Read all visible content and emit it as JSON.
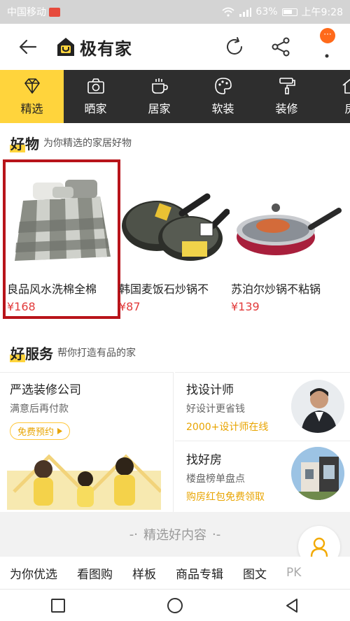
{
  "status_bar": {
    "carrier": "中国移动",
    "battery": "63%",
    "time": "上午9:28"
  },
  "app": {
    "brand": "极有家",
    "more_badge": "···"
  },
  "tabs": [
    {
      "label": "精选",
      "icon": "diamond-icon",
      "active": true
    },
    {
      "label": "晒家",
      "icon": "camera-icon",
      "active": false
    },
    {
      "label": "居家",
      "icon": "cup-icon",
      "active": false
    },
    {
      "label": "软装",
      "icon": "palette-icon",
      "active": false
    },
    {
      "label": "装修",
      "icon": "paint-roller-icon",
      "active": false
    },
    {
      "label": "房",
      "icon": "house-icon",
      "active": false
    }
  ],
  "goods": {
    "title_hl": "好",
    "title_rest": "物",
    "subtitle": "为你精选的家居好物",
    "products": [
      {
        "name": "良品风水洗棉全棉",
        "price": "¥168"
      },
      {
        "name": "韩国麦饭石炒锅不",
        "price": "¥87"
      },
      {
        "name": "苏泊尔炒锅不粘锅",
        "price": "¥139"
      }
    ]
  },
  "services": {
    "title_hl": "好",
    "title_rest": "服务",
    "subtitle": "帮你打造有品的家",
    "renovation": {
      "title": "严选装修公司",
      "sub": "满意后再付款",
      "button": "免费预约"
    },
    "designer": {
      "title": "找设计师",
      "sub": "好设计更省钱",
      "highlight": "2000+设计师在线"
    },
    "house": {
      "title": "找好房",
      "sub": "楼盘榜单盘点",
      "highlight": "购房红包免费领取"
    }
  },
  "recommend": {
    "label": "精选好内容"
  },
  "bottom_tabs": [
    "为你优选",
    "看图购",
    "样板",
    "商品专辑",
    "图文",
    "PK"
  ],
  "colors": {
    "accent": "#ffd43c",
    "price": "#e23b3b",
    "highlight": "#e8a400",
    "selection": "#b8141a"
  }
}
